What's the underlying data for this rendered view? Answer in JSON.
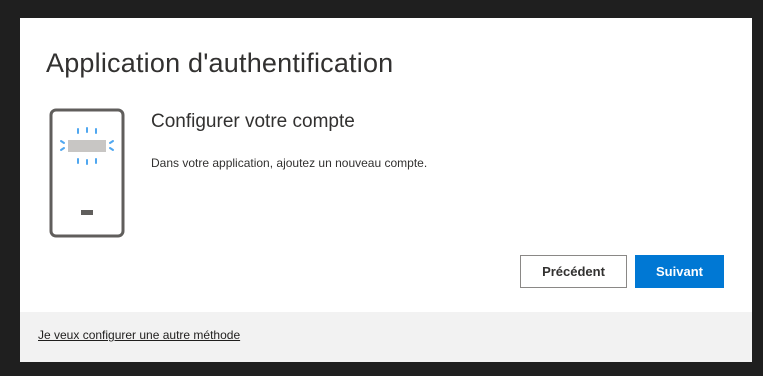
{
  "header": {
    "title": "Application d'authentification"
  },
  "step": {
    "heading": "Configurer votre compte",
    "description": "Dans votre application, ajoutez un nouveau compte.",
    "illustration_icon": "phone-qr-icon"
  },
  "actions": {
    "previous_label": "Précédent",
    "next_label": "Suivant"
  },
  "footer": {
    "alternate_method_link": "Je veux configurer une autre méthode"
  },
  "colors": {
    "primary": "#0078d4",
    "text": "#323130",
    "footer_bg": "#f2f2f2",
    "outer_bg": "#1f1f1f"
  }
}
